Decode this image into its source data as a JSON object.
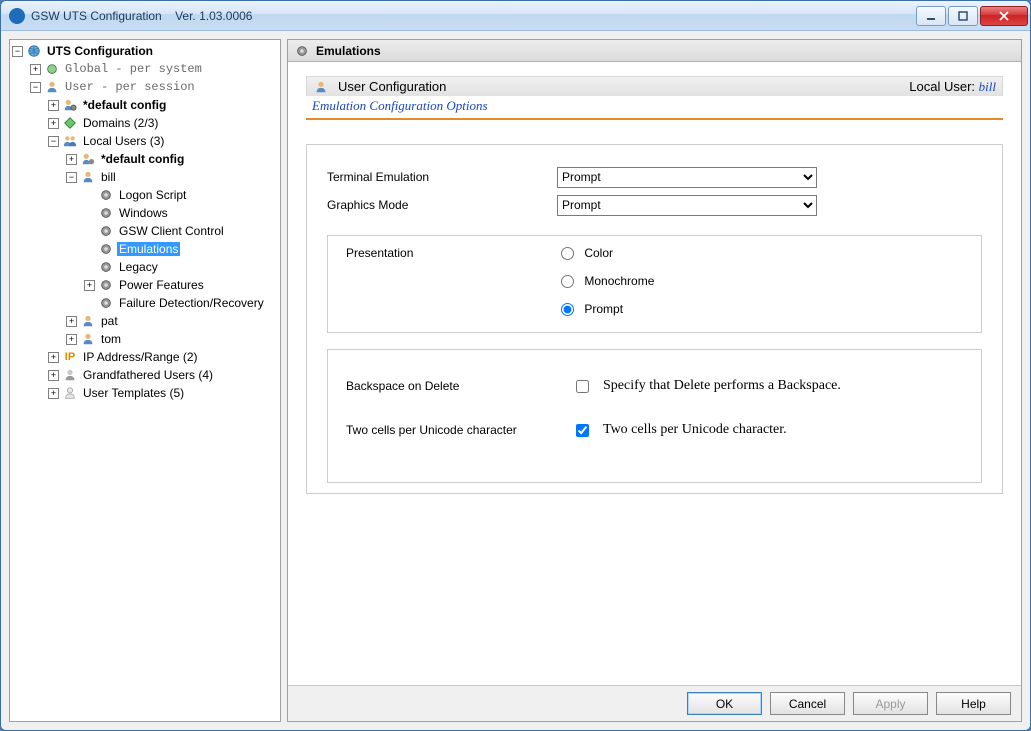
{
  "window": {
    "title": "GSW UTS Configuration",
    "version": "Ver. 1.03.0006"
  },
  "tree": {
    "root": "UTS Configuration",
    "global": "Global - per system",
    "user": "User   - per session",
    "default_config": "*default config",
    "domains": "Domains (2/3)",
    "local_users": "Local Users (3)",
    "default_config2": "*default config",
    "bill": "bill",
    "bill_children": {
      "logon_script": "Logon Script",
      "windows": "Windows",
      "gsw_client": "GSW Client Control",
      "emulations": "Emulations",
      "legacy": "Legacy",
      "power": "Power Features",
      "failure": "Failure Detection/Recovery"
    },
    "pat": "pat",
    "tom": "tom",
    "ip_range": "IP Address/Range (2)",
    "grandfathered": "Grandfathered Users (4)",
    "user_templates": "User Templates (5)"
  },
  "panel": {
    "title": "Emulations",
    "user_config": "User Configuration",
    "local_user_label": "Local User: ",
    "local_user_name": "bill",
    "subtitle": "Emulation Configuration Options"
  },
  "form": {
    "terminal_emulation_label": "Terminal Emulation",
    "terminal_emulation_value": "Prompt",
    "graphics_mode_label": "Graphics Mode",
    "graphics_mode_value": "Prompt",
    "presentation_label": "Presentation",
    "presentation_options": {
      "color": "Color",
      "mono": "Monochrome",
      "prompt": "Prompt"
    },
    "presentation_selected": "prompt",
    "backspace_label": "Backspace on Delete",
    "backspace_desc": "Specify that Delete performs a Backspace.",
    "backspace_checked": false,
    "twocell_label": "Two cells per Unicode character",
    "twocell_desc": "Two cells per Unicode character.",
    "twocell_checked": true
  },
  "buttons": {
    "ok": "OK",
    "cancel": "Cancel",
    "apply": "Apply",
    "help": "Help"
  }
}
